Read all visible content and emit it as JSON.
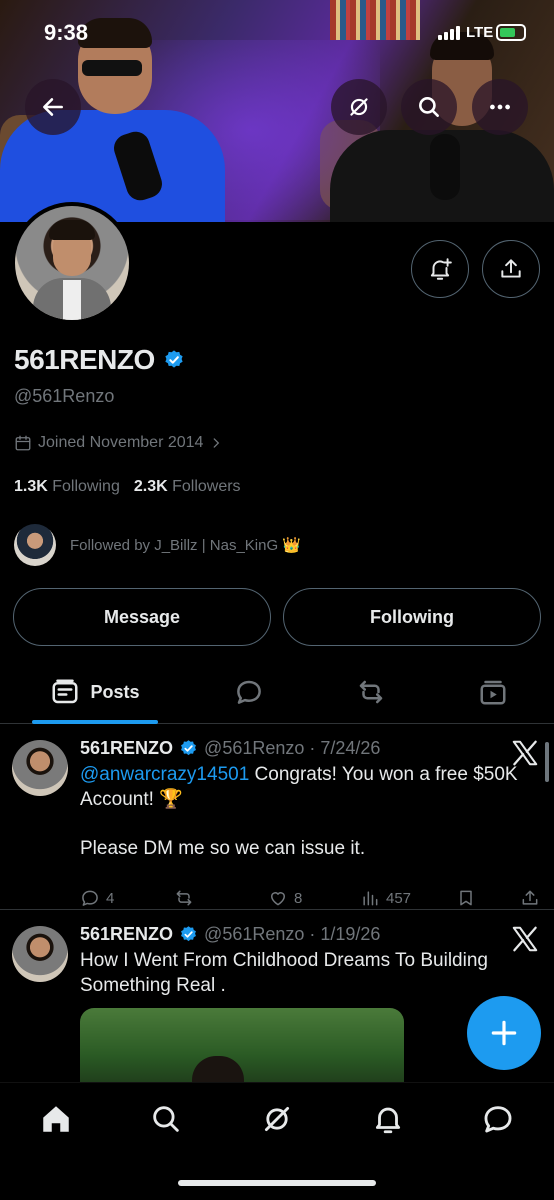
{
  "status_bar": {
    "time": "9:38",
    "network": "LTE"
  },
  "profile": {
    "name": "561RENZO",
    "handle": "@561Renzo",
    "joined": "Joined November 2014",
    "following_count": "1.3K",
    "following_label": "Following",
    "followers_count": "2.3K",
    "followers_label": "Followers",
    "followed_by": "Followed by J_Billz | Nas_KinG 👑"
  },
  "buttons": {
    "message": "Message",
    "following": "Following"
  },
  "tabs": [
    {
      "label": "Posts",
      "icon": "posts-icon",
      "active": true
    },
    {
      "label": "",
      "icon": "replies-icon"
    },
    {
      "label": "",
      "icon": "reposts-icon"
    },
    {
      "label": "",
      "icon": "media-icon"
    }
  ],
  "posts": [
    {
      "author": "561RENZO",
      "meta": "@561Renzo · 7/24/26",
      "mention": "@anwarcrazy14501",
      "text1": " Congrats! You won a free $50K Account! 🏆",
      "text2": "Please DM me so we can issue it.",
      "replies": "4",
      "likes": "8",
      "views": "457"
    },
    {
      "author": "561RENZO",
      "meta": "@561Renzo · 1/19/26",
      "text1": "How I Went From Childhood Dreams To Building Something Real ."
    }
  ],
  "colors": {
    "accent": "#1d9bf0",
    "muted": "#71767b",
    "border": "#2f3336"
  }
}
